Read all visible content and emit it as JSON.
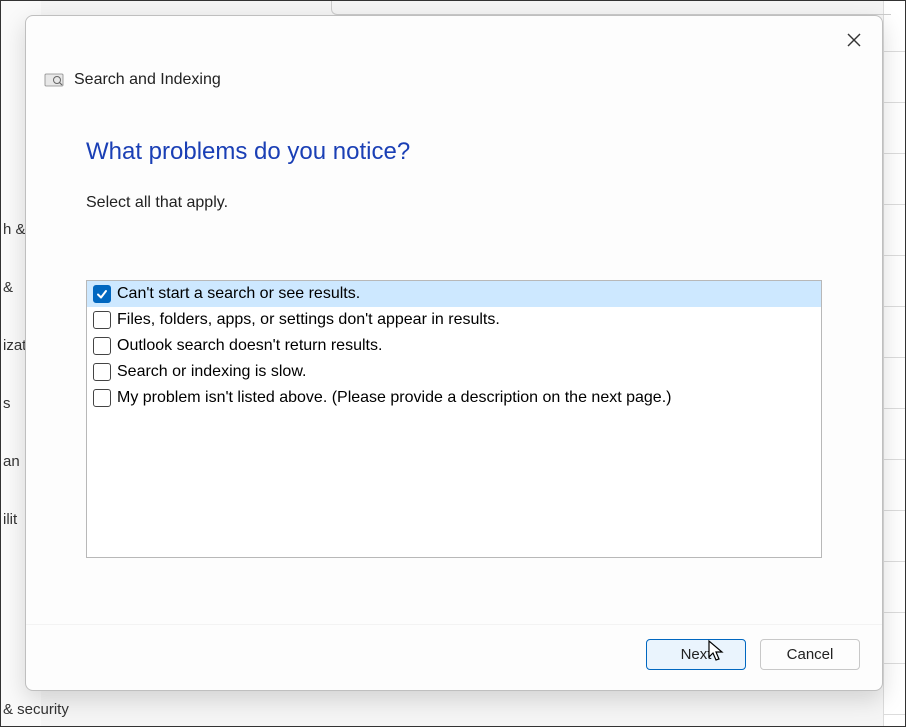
{
  "dialog": {
    "title": "Search and Indexing",
    "heading": "What problems do you notice?",
    "subtext": "Select all that apply.",
    "options": [
      {
        "label": "Can't start a search or see results.",
        "checked": true
      },
      {
        "label": "Files, folders, apps, or settings don't appear in results.",
        "checked": false
      },
      {
        "label": "Outlook search doesn't return results.",
        "checked": false
      },
      {
        "label": "Search or indexing is slow.",
        "checked": false
      },
      {
        "label": "My problem isn't listed above. (Please provide a description on the next page.)",
        "checked": false
      }
    ],
    "buttons": {
      "next": "Next",
      "cancel": "Cancel"
    }
  },
  "background": {
    "sidebar_fragments": [
      "h &",
      " &",
      "izat",
      "s",
      "an",
      "ilit"
    ],
    "bottom_fragment": "& security"
  }
}
